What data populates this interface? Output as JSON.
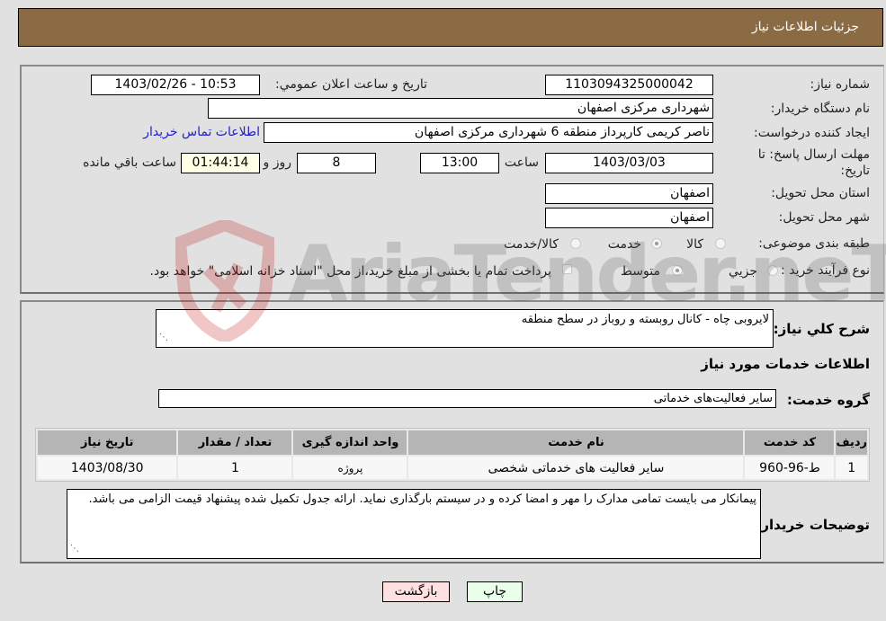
{
  "header": {
    "title": "جزئیات اطلاعات نیاز"
  },
  "form": {
    "need_number": {
      "label": "شماره نیاز:",
      "value": "1103094325000042"
    },
    "announce_datetime": {
      "label": "تاریخ و ساعت اعلان عمومي:",
      "value": "1403/02/26 - 10:53"
    },
    "buyer_org": {
      "label": "نام دستگاه خريدار:",
      "value": "شهرداری مرکزی اصفهان"
    },
    "requester": {
      "label": "ايجاد کننده درخواست:",
      "value": "ناصر کریمی کارپرداز منطقه 6 شهرداری مرکزی اصفهان"
    },
    "contact_link": "اطلاعات تماس خريدار",
    "deadline": {
      "label_line1": "مهلت ارسال پاسخ: تا",
      "label_line2": "تاريخ:",
      "date": "1403/03/03",
      "time_label": "ساعت",
      "time": "13:00",
      "days": "8",
      "days_label": "روز و",
      "remaining": "01:44:14",
      "remaining_label": "ساعت باقي مانده"
    },
    "province": {
      "label": "استان محل تحويل:",
      "value": "اصفهان"
    },
    "city": {
      "label": "شهر محل تحويل:",
      "value": "اصفهان"
    },
    "category": {
      "label": "طبقه بندی موضوعی:",
      "options": [
        {
          "label": "کالا",
          "selected": false
        },
        {
          "label": "خدمت",
          "selected": true
        },
        {
          "label": "کالا/خدمت",
          "selected": false
        }
      ]
    },
    "process": {
      "label": "نوع فرآيند خريد :",
      "options": [
        {
          "label": "جزيي",
          "selected": false
        },
        {
          "label": "متوسط",
          "selected": true
        }
      ],
      "treasury_checkbox": {
        "checked": false,
        "label": "پرداخت تمام يا بخشی از مبلغ خريد،از محل \"اسناد خزانه اسلامی\" خواهد بود."
      }
    }
  },
  "details": {
    "summary": {
      "label": "شرح کلي نياز:",
      "value": "لایروبی چاه - کانال روبسته و روباز در سطح منطقه"
    },
    "services_heading": "اطلاعات خدمات مورد نياز",
    "service_group": {
      "label": "گروه خدمت:",
      "value": "سایر فعالیت‌های خدماتی"
    },
    "table": {
      "headers": [
        "رديف",
        "کد خدمت",
        "نام خدمت",
        "واحد اندازه گيری",
        "تعداد / مقدار",
        "تاريخ نياز"
      ],
      "rows": [
        [
          "1",
          "ط-96-960",
          "سایر فعالیت های خدماتی شخصی",
          "پروژه",
          "1",
          "1403/08/30"
        ]
      ]
    },
    "buyer_notes": {
      "label": "توضيحات خريدار:",
      "value": "پیمانکار می بایست تمامی مدارک را مهر و امضا کرده و در سیستم بارگذاری نماید. ارائه جدول تکمیل شده پیشنهاد قیمت الزامی می باشد."
    }
  },
  "buttons": {
    "print": "چاپ",
    "back": "بازگشت"
  },
  "watermark": "AriaTender.neT",
  "colors": {
    "header_bg": "#8b6b43",
    "print_bg": "#eaffea",
    "back_bg": "#ffe0e0",
    "link": "#2020c8"
  }
}
